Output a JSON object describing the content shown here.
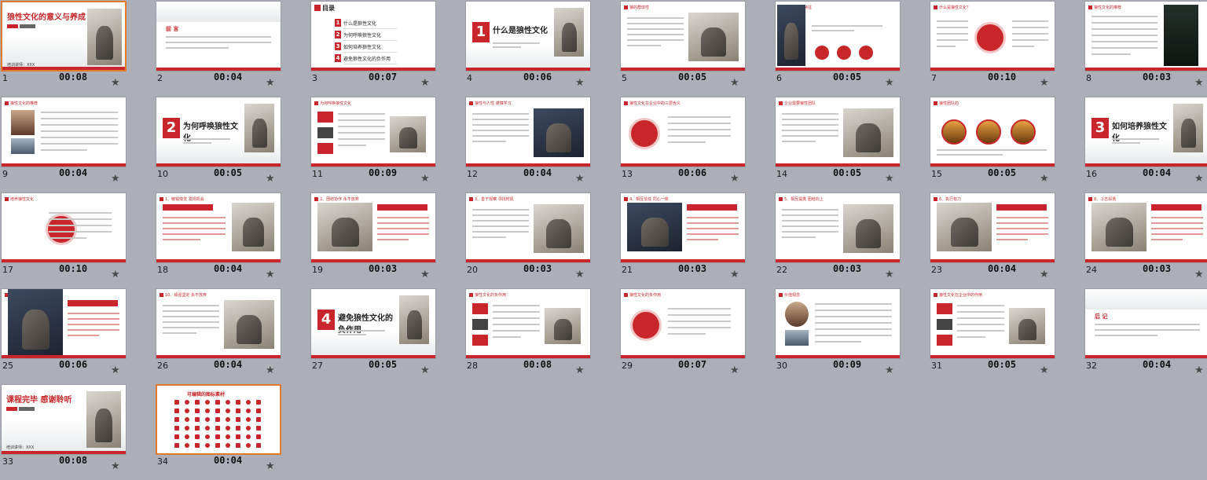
{
  "slides": [
    {
      "num": "1",
      "time": "00:08",
      "title": "狼性文化的意义与养成",
      "subtitle": "培训讲师：XXX",
      "tag": "汇报",
      "selected": true
    },
    {
      "num": "2",
      "time": "00:04",
      "title": "前 言"
    },
    {
      "num": "3",
      "time": "00:07",
      "title": "目录",
      "items": [
        "什么是狼性文化",
        "为何呼唤狼性文化",
        "如何培养狼性文化",
        "避免狼性文化的负作用"
      ]
    },
    {
      "num": "4",
      "time": "00:06",
      "title": "什么是狼性文化",
      "big": "1"
    },
    {
      "num": "5",
      "time": "00:05",
      "title": "狼的群体性"
    },
    {
      "num": "6",
      "time": "00:05",
      "title": "狼性的三个特征"
    },
    {
      "num": "7",
      "time": "00:10",
      "title": "什么是狼性文化？"
    },
    {
      "num": "8",
      "time": "00:03",
      "title": "狼性文化的推荐"
    },
    {
      "num": "9",
      "time": "00:04",
      "title": "狼性文化的推荐"
    },
    {
      "num": "10",
      "time": "00:05",
      "title": "为何呼唤狼性文化",
      "big": "2"
    },
    {
      "num": "11",
      "time": "00:09",
      "title": "为何呼唤狼性文化"
    },
    {
      "num": "12",
      "time": "00:04",
      "title": "狼性与人性 谨慎学习"
    },
    {
      "num": "13",
      "time": "00:06",
      "title": "狼性文化在企业中的三层含义"
    },
    {
      "num": "14",
      "time": "00:05",
      "title": "企业需要狼性团队"
    },
    {
      "num": "15",
      "time": "00:05",
      "title": "狼性团队的"
    },
    {
      "num": "16",
      "time": "00:04",
      "title": "如何培养狼性文化",
      "big": "3"
    },
    {
      "num": "17",
      "time": "00:10",
      "title": "培养狼性文化"
    },
    {
      "num": "18",
      "time": "00:04",
      "title": "1、敏锐嗅觉 发现机会"
    },
    {
      "num": "19",
      "time": "00:03",
      "title": "2、团结协作 永不放弃"
    },
    {
      "num": "20",
      "time": "00:03",
      "title": "3、善于观察 寻找时机"
    },
    {
      "num": "21",
      "time": "00:03",
      "title": "4、相互信任 同心一体"
    },
    {
      "num": "22",
      "time": "00:03",
      "title": "5、相互提携 团结向上"
    },
    {
      "num": "23",
      "time": "00:04",
      "title": "6、执行有力"
    },
    {
      "num": "24",
      "time": "00:03",
      "title": "8、斗志昂扬"
    },
    {
      "num": "25",
      "time": "00:06",
      "title": "9、勇敢冒险 领袖精神"
    },
    {
      "num": "26",
      "time": "00:04",
      "title": "10、顽强坚定 永不放弃"
    },
    {
      "num": "27",
      "time": "00:05",
      "title": "避免狼性文化的负作用",
      "big": "4"
    },
    {
      "num": "28",
      "time": "00:08",
      "title": "狼性文化的负作用"
    },
    {
      "num": "29",
      "time": "00:07",
      "title": "狼性文化的负作用"
    },
    {
      "num": "30",
      "time": "00:09",
      "title": "价值观念"
    },
    {
      "num": "31",
      "time": "00:05",
      "title": "狼性文化在企业中的作用"
    },
    {
      "num": "32",
      "time": "00:04",
      "title": "后 记"
    },
    {
      "num": "33",
      "time": "00:08",
      "title": "课程完毕 感谢聆听",
      "subtitle": "培训讲师：XXX",
      "tag": "汇报"
    },
    {
      "num": "34",
      "time": "00:04",
      "title": "可编辑的图标素材",
      "selected": true
    }
  ],
  "colors": {
    "accent": "#c8262a",
    "background": "#adafb8",
    "selection": "#e07a2e"
  },
  "icons": {
    "star": "star-icon"
  }
}
